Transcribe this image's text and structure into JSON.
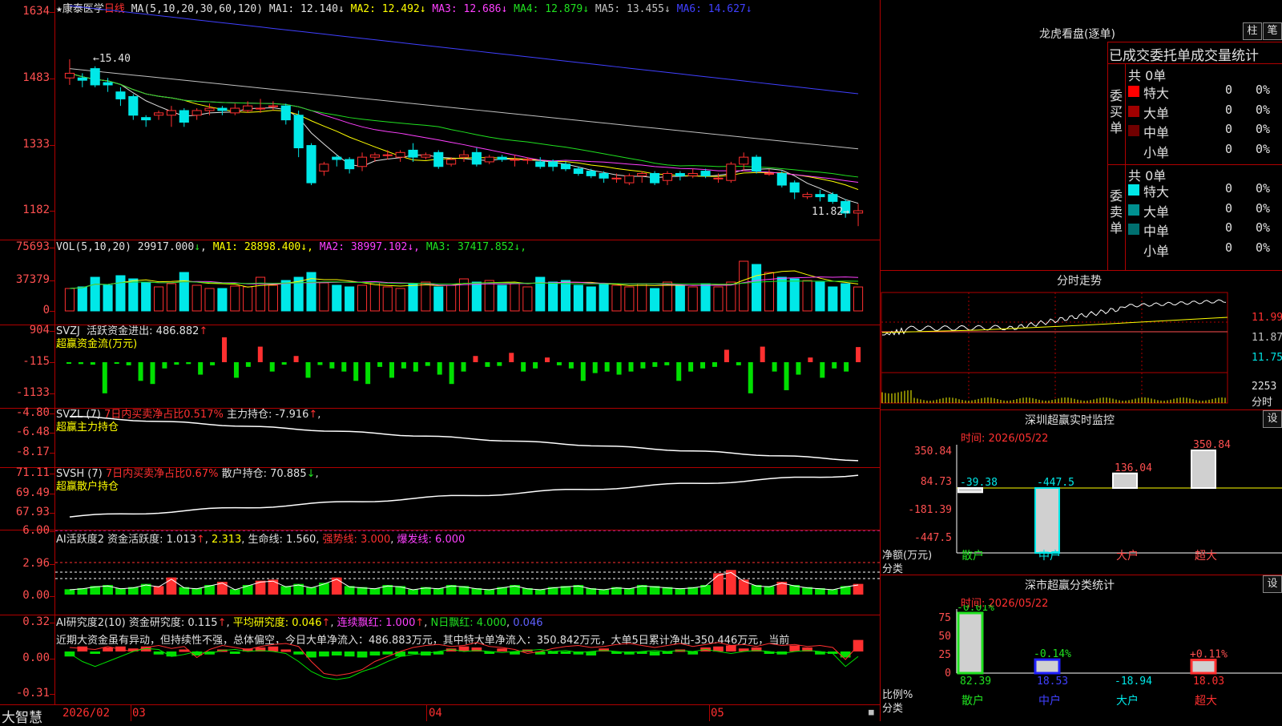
{
  "stock": {
    "name": "康泰医学",
    "period": "日线"
  },
  "colors": {
    "up": "#ff3030",
    "down": "#00e8e8",
    "grid": "#b00000",
    "bg": "#000000"
  },
  "price_panel": {
    "ma_header": "MA(5,10,20,30,60,120)",
    "ma": [
      {
        "label": "MA1: 12.140",
        "arrow": "↓",
        "color": "#e0e0e0"
      },
      {
        "label": "MA2: 12.492",
        "arrow": "↓",
        "color": "#ffff00"
      },
      {
        "label": "MA3: 12.686",
        "arrow": "↓",
        "color": "#ff40ff"
      },
      {
        "label": "MA4: 12.879",
        "arrow": "↓",
        "color": "#20e020"
      },
      {
        "label": "MA5: 13.455",
        "arrow": "↓",
        "color": "#c0c0c0"
      },
      {
        "label": "MA6: 14.627",
        "arrow": "↓",
        "color": "#4040ff"
      }
    ],
    "y_ticks": [
      "1634",
      "1483",
      "1333",
      "1182"
    ],
    "high_mark": "15.40",
    "low_mark": "11.82",
    "candles": [
      [
        15.0,
        15.1,
        14.85,
        15.4
      ],
      [
        15.0,
        14.95,
        14.8,
        15.1
      ],
      [
        15.2,
        14.85,
        14.8,
        15.25
      ],
      [
        14.9,
        14.85,
        14.7,
        15.0
      ],
      [
        14.7,
        14.55,
        14.4,
        14.8
      ],
      [
        14.6,
        14.2,
        14.1,
        14.65
      ],
      [
        14.15,
        14.1,
        13.95,
        14.2
      ],
      [
        14.2,
        14.25,
        14.1,
        14.3
      ],
      [
        14.2,
        14.3,
        13.95,
        14.4
      ],
      [
        14.3,
        14.05,
        13.95,
        14.35
      ],
      [
        14.2,
        14.3,
        14.1,
        14.35
      ],
      [
        14.3,
        14.35,
        14.2,
        14.45
      ],
      [
        14.35,
        14.3,
        14.2,
        14.4
      ],
      [
        14.25,
        14.35,
        14.2,
        14.45
      ],
      [
        14.3,
        14.4,
        14.25,
        14.5
      ],
      [
        14.35,
        14.35,
        14.25,
        14.55
      ],
      [
        14.4,
        14.4,
        14.3,
        14.5
      ],
      [
        14.4,
        14.1,
        14.0,
        14.45
      ],
      [
        14.2,
        13.5,
        13.3,
        14.3
      ],
      [
        13.55,
        12.75,
        12.7,
        13.6
      ],
      [
        13.0,
        13.15,
        12.9,
        13.2
      ],
      [
        13.3,
        13.25,
        13.1,
        13.35
      ],
      [
        13.25,
        13.05,
        12.95,
        13.3
      ],
      [
        13.1,
        13.3,
        13.0,
        13.4
      ],
      [
        13.3,
        13.35,
        13.2,
        13.4
      ],
      [
        13.35,
        13.35,
        13.25,
        13.45
      ],
      [
        13.3,
        13.4,
        13.2,
        13.45
      ],
      [
        13.45,
        13.3,
        13.2,
        13.6
      ],
      [
        13.3,
        13.35,
        13.25,
        13.4
      ],
      [
        13.4,
        13.1,
        13.05,
        13.45
      ],
      [
        13.15,
        13.25,
        13.1,
        13.3
      ],
      [
        13.3,
        13.35,
        13.2,
        13.45
      ],
      [
        13.4,
        13.15,
        13.1,
        13.5
      ],
      [
        13.2,
        13.3,
        13.15,
        13.35
      ],
      [
        13.3,
        13.25,
        13.2,
        13.35
      ],
      [
        13.25,
        13.25,
        13.1,
        13.35
      ],
      [
        13.25,
        13.25,
        13.15,
        13.3
      ],
      [
        13.2,
        13.1,
        13.05,
        13.3
      ],
      [
        13.2,
        13.1,
        13.0,
        13.25
      ],
      [
        13.15,
        13.05,
        13.0,
        13.2
      ],
      [
        13.05,
        12.95,
        12.9,
        13.1
      ],
      [
        13.0,
        12.9,
        12.85,
        13.05
      ],
      [
        12.95,
        12.85,
        12.75,
        13.0
      ],
      [
        12.85,
        12.85,
        12.75,
        12.95
      ],
      [
        12.75,
        12.9,
        12.7,
        12.95
      ],
      [
        12.9,
        12.95,
        12.75,
        13.0
      ],
      [
        12.95,
        12.75,
        12.7,
        13.0
      ],
      [
        12.8,
        12.95,
        12.7,
        13.0
      ],
      [
        12.95,
        12.9,
        12.8,
        13.0
      ],
      [
        12.9,
        12.95,
        12.85,
        13.05
      ],
      [
        13.0,
        12.9,
        12.85,
        13.05
      ],
      [
        12.85,
        12.85,
        12.75,
        12.95
      ],
      [
        12.8,
        13.15,
        12.75,
        13.2
      ],
      [
        13.15,
        13.3,
        13.0,
        13.4
      ],
      [
        13.3,
        13.0,
        12.95,
        13.35
      ],
      [
        12.95,
        12.95,
        12.9,
        13.05
      ],
      [
        12.95,
        12.7,
        12.65,
        13.0
      ],
      [
        12.75,
        12.55,
        12.4,
        12.8
      ],
      [
        12.45,
        12.5,
        12.4,
        12.55
      ],
      [
        12.5,
        12.45,
        12.35,
        12.6
      ],
      [
        12.5,
        12.35,
        12.3,
        12.55
      ],
      [
        12.35,
        12.1,
        12.0,
        12.4
      ],
      [
        12.1,
        12.15,
        11.82,
        12.3
      ]
    ]
  },
  "vol_panel": {
    "header": "VOL(5,10,20)",
    "value": "29917.000",
    "mas": [
      {
        "label": "MA1: 28898.400",
        "arrow": "↓",
        "color": "#ffff00"
      },
      {
        "label": "MA2: 38997.102",
        "arrow": "↓",
        "color": "#ff40ff"
      },
      {
        "label": "MA3: 37417.852",
        "arrow": "↓",
        "color": "#20e020"
      }
    ],
    "y_ticks": [
      "75693",
      "37379",
      "0"
    ],
    "values": [
      28000,
      30000,
      42000,
      32000,
      44000,
      40000,
      36000,
      30000,
      34000,
      48000,
      32000,
      28000,
      28000,
      31000,
      30000,
      42000,
      32000,
      38000,
      42000,
      48000,
      35000,
      32000,
      30000,
      32000,
      35000,
      30000,
      28000,
      34000,
      36000,
      30000,
      32000,
      40000,
      36000,
      38000,
      32000,
      34000,
      30000,
      42000,
      36000,
      38000,
      32000,
      30000,
      34000,
      32000,
      30000,
      34000,
      28000,
      36000,
      32000,
      30000,
      34000,
      30000,
      36000,
      62000,
      58000,
      48000,
      42000,
      40000,
      38000,
      36000,
      30000,
      34000,
      29917
    ]
  },
  "svzj_panel": {
    "header": "SVZJ",
    "l1": "活跃资金进出: 486.882",
    "l1_arrow": "↑",
    "l2": "超赢资金流(万元)",
    "y_ticks": [
      "904",
      "-115",
      "-1133"
    ],
    "values": [
      -50,
      -60,
      -80,
      -1000,
      -40,
      -100,
      -600,
      -700,
      -200,
      -80,
      -60,
      -400,
      -100,
      800,
      -500,
      -150,
      500,
      -300,
      -80,
      200,
      -500,
      -90,
      -200,
      -300,
      -600,
      -700,
      -150,
      -500,
      -200,
      -300,
      -120,
      -400,
      -700,
      -300,
      200,
      -150,
      -120,
      300,
      -300,
      -200,
      150,
      -100,
      -200,
      -600,
      -350,
      -300,
      -400,
      -300,
      -200,
      -150,
      -100,
      -600,
      -300,
      -200,
      -150,
      400,
      -100,
      -1000,
      500,
      -300,
      -900,
      -400,
      150,
      -500,
      -200,
      -300,
      486
    ]
  },
  "svzl_panel": {
    "header": "SVZL (7)",
    "l1": "7日内买卖净占比0.517%",
    "l2": "主力持仓: -7.916",
    "l2_arrow": "↑",
    "l3": "超赢主力持仓",
    "y_ticks": [
      "-4.80",
      "-6.48",
      "-8.17"
    ]
  },
  "svsh_panel": {
    "header": "SVSH (7)",
    "l1": "7日内买卖净占比0.67%",
    "l2": "散户持仓: 70.885",
    "l2_arrow": "↓",
    "l3": "超赢散户持仓",
    "y_ticks": [
      "71.11",
      "69.49",
      "67.93"
    ]
  },
  "ai_active_panel": {
    "header": "AI活跃度2",
    "l1": "资金活跃度: 1.013",
    "l2": "2.313",
    "l3": "生命线: 1.560",
    "l4": "强势线: 3.000",
    "l5": "爆发线: 6.000",
    "y_ticks": [
      "6.00",
      "2.96",
      "0.00"
    ]
  },
  "ai_research_panel": {
    "header": "AI研究度2(10)",
    "l1": "资金研究度: 0.115",
    "l2": "平均研究度: 0.046",
    "l3": "连续飘红: 1.000",
    "l4": "N日飘红: 4.000",
    "l5": "0.046",
    "summary": "近期大资金虽有异动，但持续性不强，总体偏空，今日大单净流入：486.883万元，其中特大单净流入：350.842万元，大单5日累计净出-350.446万元，当前",
    "y_ticks": [
      "0.32",
      "0.00",
      "-0.31"
    ]
  },
  "bottom_axis": {
    "brand": "大智慧",
    "labels": [
      "2026/02",
      "03",
      "04",
      "05"
    ]
  },
  "dragon_tiger": {
    "title": "龙虎看盘(逐单)",
    "tabs": [
      "柱",
      "笔"
    ],
    "header": "已成交委托单成交量统计",
    "buy_label": "委买单",
    "sell_label": "委卖单",
    "buy_total": "共 0单",
    "sell_total": "共 0单",
    "rows_buy": [
      {
        "name": "特大",
        "count": "0",
        "pct": "0%",
        "color": "#ff0000"
      },
      {
        "name": "大单",
        "count": "0",
        "pct": "0%",
        "color": "#a00000"
      },
      {
        "name": "中单",
        "count": "0",
        "pct": "0%",
        "color": "#700000"
      },
      {
        "name": "小单",
        "count": "0",
        "pct": "0%",
        "color": "#000000"
      }
    ],
    "rows_sell": [
      {
        "name": "特大",
        "count": "0",
        "pct": "0%",
        "color": "#00e8e8"
      },
      {
        "name": "大单",
        "count": "0",
        "pct": "0%",
        "color": "#009090"
      },
      {
        "name": "中单",
        "count": "0",
        "pct": "0%",
        "color": "#007070"
      },
      {
        "name": "小单",
        "count": "0",
        "pct": "0%",
        "color": "#000000"
      }
    ]
  },
  "intraday": {
    "title": "分时走势",
    "price_ticks": [
      "11.99",
      "11.87",
      "11.75"
    ],
    "vol_tick": "2253",
    "vol_label": "分时"
  },
  "sz_monitor": {
    "title": "深圳超赢实时监控",
    "setting": "设",
    "time": "时间: 2026/05/22",
    "y_ticks": [
      "350.84",
      "84.73",
      "-181.39",
      "-447.5"
    ],
    "y_label_1": "净额(万元)",
    "y_label_2": "分类",
    "categories": [
      "散户",
      "中户",
      "大户",
      "超大"
    ],
    "values": [
      -39.38,
      -447.5,
      136.04,
      350.84
    ],
    "value_labels": [
      "-39.38",
      "-447.5",
      "136.04",
      "350.84"
    ]
  },
  "sz_classify": {
    "title": "深市超赢分类统计",
    "setting": "设",
    "time": "时间: 2026/05/22",
    "y_ticks": [
      "75",
      "50",
      "25",
      "0"
    ],
    "y_label_1": "比例%",
    "y_label_2": "分类",
    "categories": [
      "散户",
      "中户",
      "大户",
      "超大"
    ],
    "values": [
      82.39,
      18.53,
      -18.94,
      18.03
    ],
    "top_labels": [
      "-0.01%",
      "-0.14%",
      "",
      "+0.11%"
    ],
    "bottom_labels": [
      "82.39",
      "18.53",
      "-18.94",
      "18.03"
    ]
  }
}
